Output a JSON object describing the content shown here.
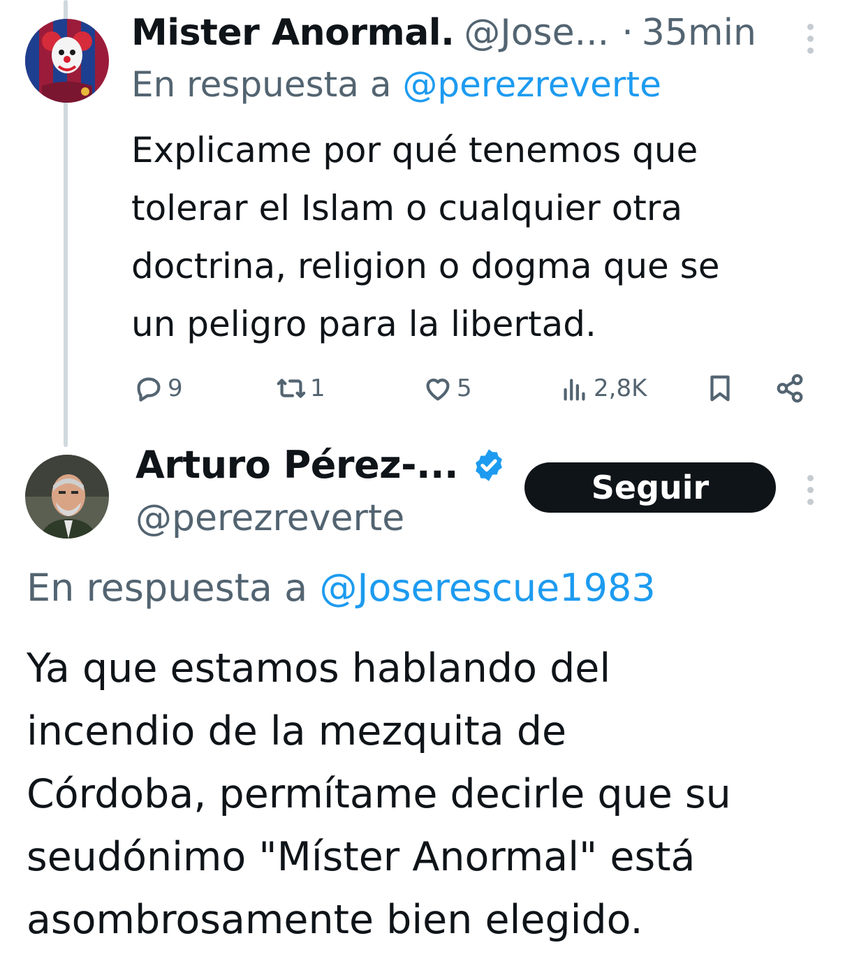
{
  "tweets": [
    {
      "author_name": "Mister Anormal.",
      "handle": "@Jose...",
      "separator": "·",
      "time": "35min",
      "reply_prefix": "En respuesta a",
      "reply_to": "@perezreverte",
      "text": "Explicame por qué tenemos que\ntolerar el Islam o cualquier otra\ndoctrina, religion o dogma que se\nun peligro para la libertad.",
      "stats": {
        "replies": "9",
        "retweets": "1",
        "likes": "5",
        "views": "2,8K"
      },
      "icons": [
        "reply-icon",
        "retweet-icon",
        "like-icon",
        "views-icon",
        "bookmark-icon",
        "share-icon",
        "more-icon"
      ]
    },
    {
      "author_name": "Arturo Pérez-...",
      "handle": "@perezreverte",
      "verified": true,
      "follow_label": "Seguir",
      "reply_prefix": "En respuesta a",
      "reply_to": "@Joserescue1983",
      "text": "Ya que estamos hablando del\nincendio de la mezquita de\nCórdoba, permítame decirle que su\nseudónimo \"Míster Anormal\" está\nasombrosamente bien elegido.",
      "icons": [
        "verified-badge-icon",
        "more-icon"
      ]
    }
  ],
  "colors": {
    "text": "#0f1419",
    "secondary": "#536471",
    "accent": "#1d9bf0",
    "thread_line": "#cfd9de",
    "button": "#0f1419"
  }
}
